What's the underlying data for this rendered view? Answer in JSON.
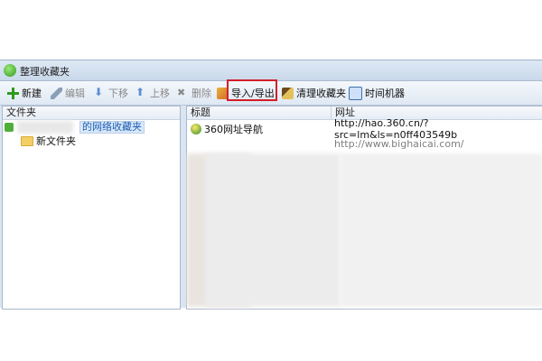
{
  "window": {
    "title": "整理收藏夹"
  },
  "toolbar": {
    "new": "新建",
    "edit": "编辑",
    "move_down": "下移",
    "move_up": "上移",
    "delete": "删除",
    "import_export": "导入/导出",
    "clean": "清理收藏夹",
    "time_machine": "时间机器"
  },
  "left_pane": {
    "header": "文件夹",
    "root_label": "的网络收藏夹",
    "child_folder": "新文件夹"
  },
  "right_pane": {
    "col_title": "标题",
    "col_url": "网址",
    "rows": [
      {
        "title": "360网址导航",
        "url": "http://hao.360.cn/?src=lm&ls=n0ff403549b"
      },
      {
        "title": "",
        "url": "http://www.bighaicai.com/"
      }
    ]
  },
  "colors": {
    "highlight": "#d21f2a",
    "accent": "#1a5fb4"
  }
}
